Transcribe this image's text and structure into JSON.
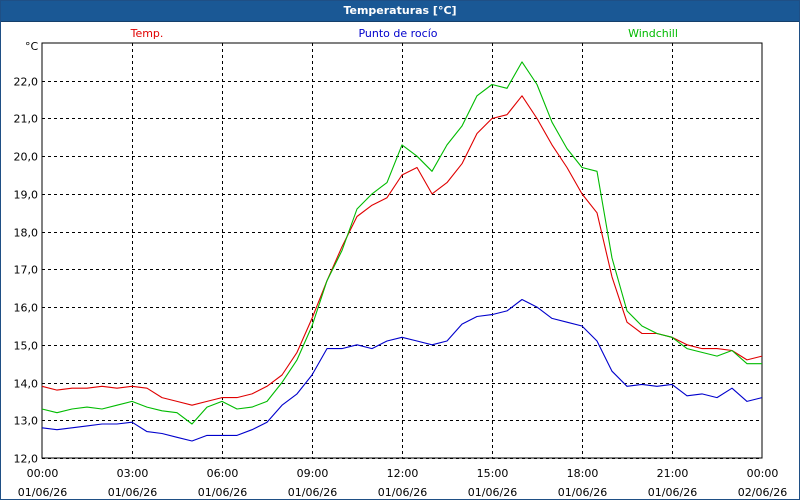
{
  "window": {
    "title": "Temperaturas [°C]"
  },
  "chart_data": {
    "type": "line",
    "unit_label": "°C",
    "ylim": [
      12.0,
      23.0
    ],
    "yticks": [
      12.0,
      13.0,
      14.0,
      15.0,
      16.0,
      17.0,
      18.0,
      19.0,
      20.0,
      21.0,
      22.0
    ],
    "ytick_labels": [
      "12,0",
      "13,0",
      "14,0",
      "15,0",
      "16,0",
      "17,0",
      "18,0",
      "19,0",
      "20,0",
      "21,0",
      "22,0"
    ],
    "xlim": [
      0,
      24
    ],
    "xticks": [
      0,
      3,
      6,
      9,
      12,
      15,
      18,
      21,
      24
    ],
    "xtick_labels": [
      [
        "00:00",
        "01/06/26"
      ],
      [
        "03:00",
        "01/06/26"
      ],
      [
        "06:00",
        "01/06/26"
      ],
      [
        "09:00",
        "01/06/26"
      ],
      [
        "12:00",
        "01/06/26"
      ],
      [
        "15:00",
        "01/06/26"
      ],
      [
        "18:00",
        "01/06/26"
      ],
      [
        "21:00",
        "01/06/26"
      ],
      [
        "00:00",
        "02/06/26"
      ]
    ],
    "grid": true,
    "legend_position": "top",
    "x": [
      0,
      0.5,
      1,
      1.5,
      2,
      2.5,
      3,
      3.5,
      4,
      4.5,
      5,
      5.5,
      6,
      6.5,
      7,
      7.5,
      8,
      8.5,
      9,
      9.5,
      10,
      10.5,
      11,
      11.5,
      12,
      12.5,
      13,
      13.5,
      14,
      14.5,
      15,
      15.5,
      16,
      16.5,
      17,
      17.5,
      18,
      18.5,
      19,
      19.5,
      20,
      20.5,
      21,
      21.5,
      22,
      22.5,
      23,
      23.5,
      24
    ],
    "series": [
      {
        "name": "Temp.",
        "color": "#e00000",
        "values": [
          13.9,
          13.8,
          13.85,
          13.85,
          13.9,
          13.85,
          13.9,
          13.85,
          13.6,
          13.5,
          13.4,
          13.5,
          13.6,
          13.6,
          13.7,
          13.9,
          14.2,
          14.8,
          15.7,
          16.7,
          17.6,
          18.4,
          18.7,
          18.9,
          19.5,
          19.7,
          19.0,
          19.3,
          19.8,
          20.6,
          21.0,
          21.1,
          21.6,
          21.0,
          20.3,
          19.7,
          19.0,
          18.5,
          16.8,
          15.6,
          15.3,
          15.3,
          15.2,
          15.0,
          14.9,
          14.9,
          14.85,
          14.6,
          14.7
        ]
      },
      {
        "name": "Punto de rocío",
        "color": "#0000cc",
        "values": [
          12.8,
          12.75,
          12.8,
          12.85,
          12.9,
          12.9,
          12.95,
          12.7,
          12.65,
          12.55,
          12.45,
          12.6,
          12.6,
          12.6,
          12.75,
          12.95,
          13.4,
          13.7,
          14.2,
          14.9,
          14.9,
          15.0,
          14.9,
          15.1,
          15.2,
          15.1,
          15.0,
          15.1,
          15.55,
          15.75,
          15.8,
          15.9,
          16.2,
          16.0,
          15.7,
          15.6,
          15.5,
          15.1,
          14.3,
          13.9,
          13.95,
          13.9,
          13.95,
          13.65,
          13.7,
          13.6,
          13.85,
          13.5,
          13.6
        ]
      },
      {
        "name": "Windchill",
        "color": "#00bb00",
        "values": [
          13.3,
          13.2,
          13.3,
          13.35,
          13.3,
          13.4,
          13.5,
          13.35,
          13.25,
          13.2,
          12.9,
          13.35,
          13.5,
          13.3,
          13.35,
          13.5,
          14.0,
          14.6,
          15.5,
          16.7,
          17.5,
          18.6,
          19.0,
          19.3,
          20.3,
          20.0,
          19.6,
          20.3,
          20.8,
          21.6,
          21.9,
          21.8,
          22.5,
          21.9,
          20.9,
          20.2,
          19.7,
          19.6,
          17.3,
          15.9,
          15.5,
          15.3,
          15.2,
          14.9,
          14.8,
          14.7,
          14.85,
          14.5,
          14.5
        ]
      }
    ]
  }
}
